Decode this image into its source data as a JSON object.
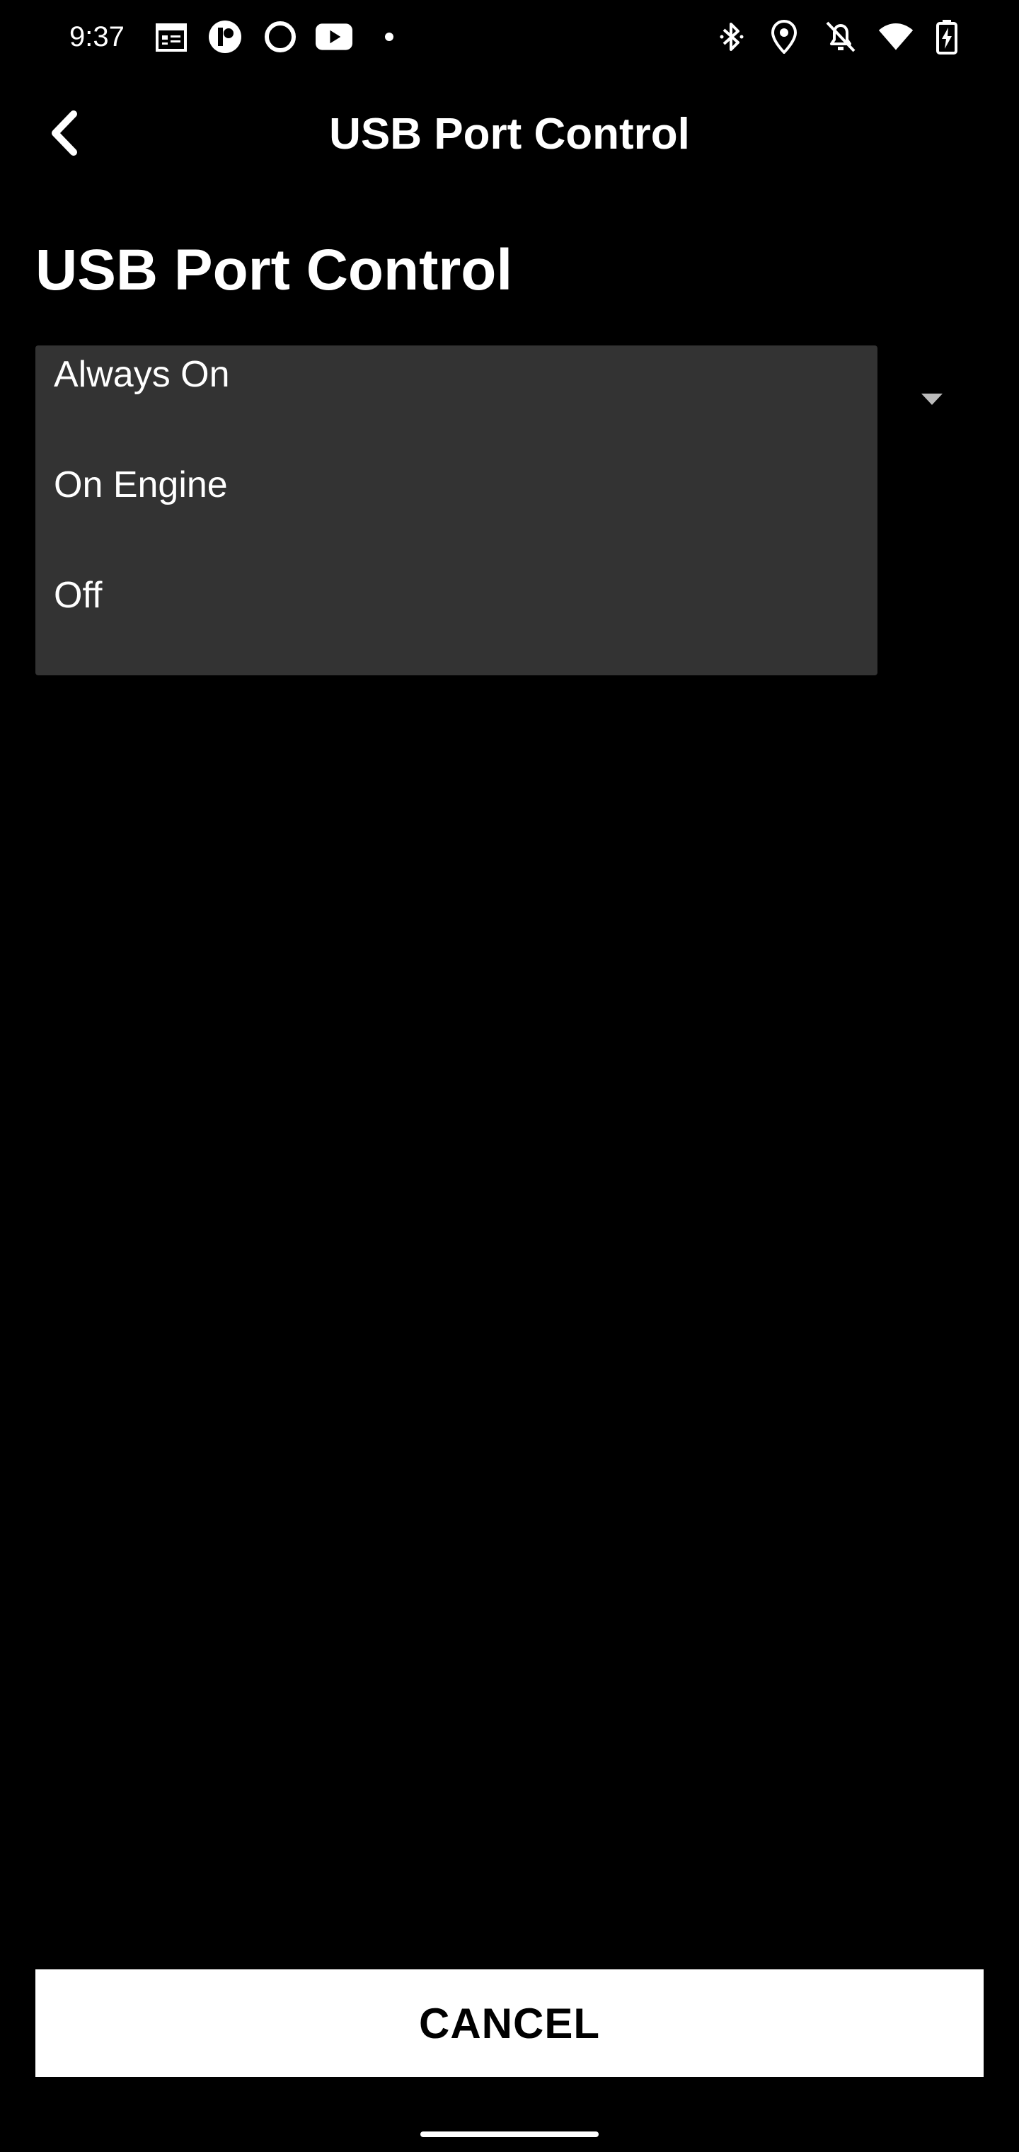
{
  "status_bar": {
    "time": "9:37",
    "left_icons": [
      "calendar-icon",
      "app-notification-icon",
      "circle-app-icon",
      "youtube-icon",
      "more-dot-icon"
    ],
    "right_icons": [
      "bluetooth-icon",
      "location-icon",
      "alarm-off-icon",
      "wifi-icon",
      "battery-charging-icon"
    ]
  },
  "app_bar": {
    "back_icon": "chevron-left-icon",
    "title": "USB Port Control"
  },
  "page": {
    "title": "USB Port Control"
  },
  "dropdown": {
    "arrow_icon": "dropdown-arrow-icon",
    "options": [
      {
        "label": "Always On"
      },
      {
        "label": "On Engine"
      },
      {
        "label": "Off"
      }
    ]
  },
  "footer": {
    "cancel_label": "CANCEL"
  },
  "colors": {
    "background": "#000000",
    "list_background": "#333333",
    "button_background": "#ffffff",
    "text": "#ffffff",
    "button_text": "#000000"
  }
}
